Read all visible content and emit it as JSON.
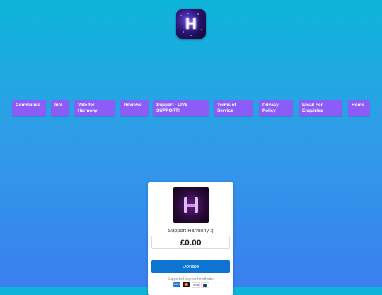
{
  "brand": {
    "logo_letter": "H"
  },
  "nav": {
    "items": [
      {
        "label": "Commands"
      },
      {
        "label": "Info"
      },
      {
        "label": "Vote for Harmony"
      },
      {
        "label": "Reviews"
      },
      {
        "label": "Support - LIVE SUPPORT!"
      },
      {
        "label": "Terms of Service"
      },
      {
        "label": "Privacy Policy"
      },
      {
        "label": "Email For Enquiries"
      },
      {
        "label": "Home"
      }
    ]
  },
  "donation": {
    "title": "Support Harmony :)",
    "amount": "£0.00",
    "donate_label": "Donate",
    "payment_methods_label": "Supported payment methods:",
    "payment_methods": [
      {
        "icon": "amex-icon",
        "text": "AMEX",
        "color": "#1f72cd"
      },
      {
        "icon": "mastercard-icon",
        "text": "",
        "color": "#111111"
      },
      {
        "icon": "visa-icon",
        "text": "VISA",
        "color": "#ffffff"
      },
      {
        "icon": "unionpay-icon",
        "text": "",
        "color": "#ffffff"
      }
    ]
  },
  "colors": {
    "nav_button": "#8b5cf6",
    "donate_button": "#0d74d1"
  }
}
